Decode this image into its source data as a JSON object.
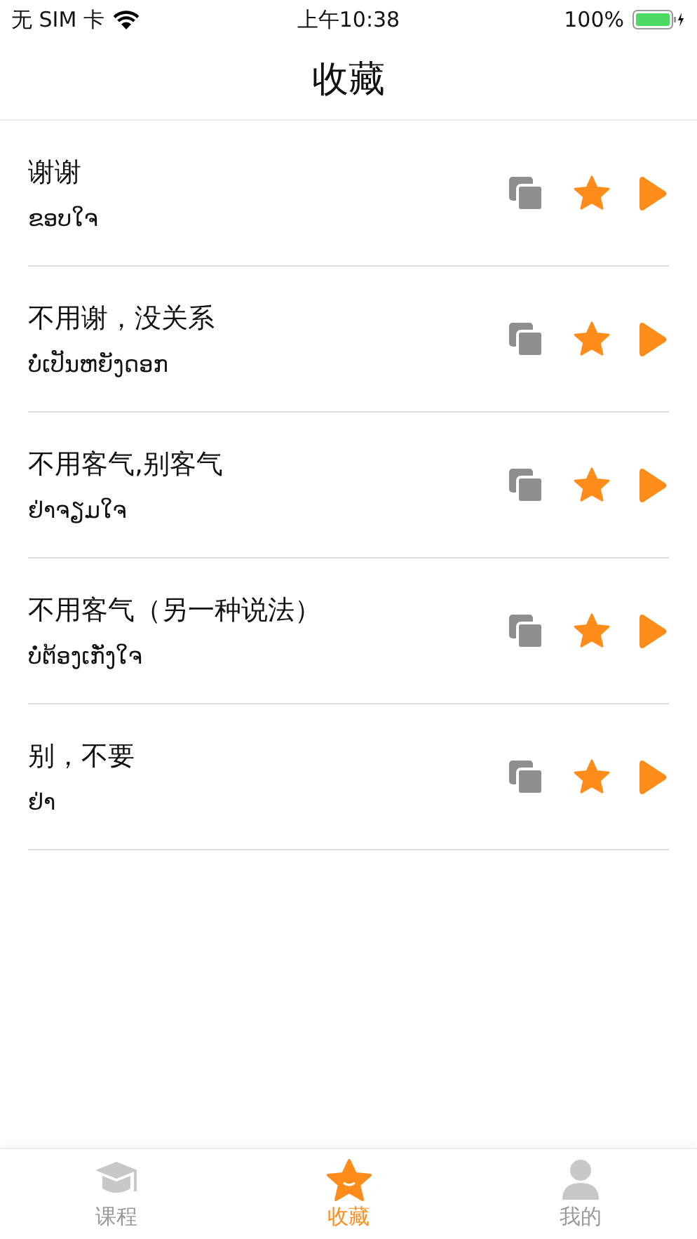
{
  "status_bar": {
    "carrier": "无 SIM 卡",
    "time": "上午10:38",
    "battery": "100%"
  },
  "nav_bar": {
    "title": "收藏"
  },
  "phrases": [
    {
      "chinese": "谢谢",
      "lao": "ຂອບໃຈ",
      "favorited": true
    },
    {
      "chinese": "不用谢，没关系",
      "lao": "ບໍ່ເປັນຫຍັງດອກ",
      "favorited": true
    },
    {
      "chinese": "不用客气,别客气",
      "lao": "ຢ່າຈຽມໃຈ",
      "favorited": true
    },
    {
      "chinese": "不用客气（另一种说法）",
      "lao": "ບໍ່ຕ້ອງເກັ່ງໃຈ",
      "favorited": true
    },
    {
      "chinese": "别，不要",
      "lao": "ຢ່າ",
      "favorited": true
    }
  ],
  "tab_bar": [
    {
      "kind": "course",
      "label": "课程",
      "selected": false
    },
    {
      "kind": "favorites",
      "label": "收藏",
      "selected": true
    },
    {
      "kind": "profile",
      "label": "我的",
      "selected": false
    }
  ]
}
